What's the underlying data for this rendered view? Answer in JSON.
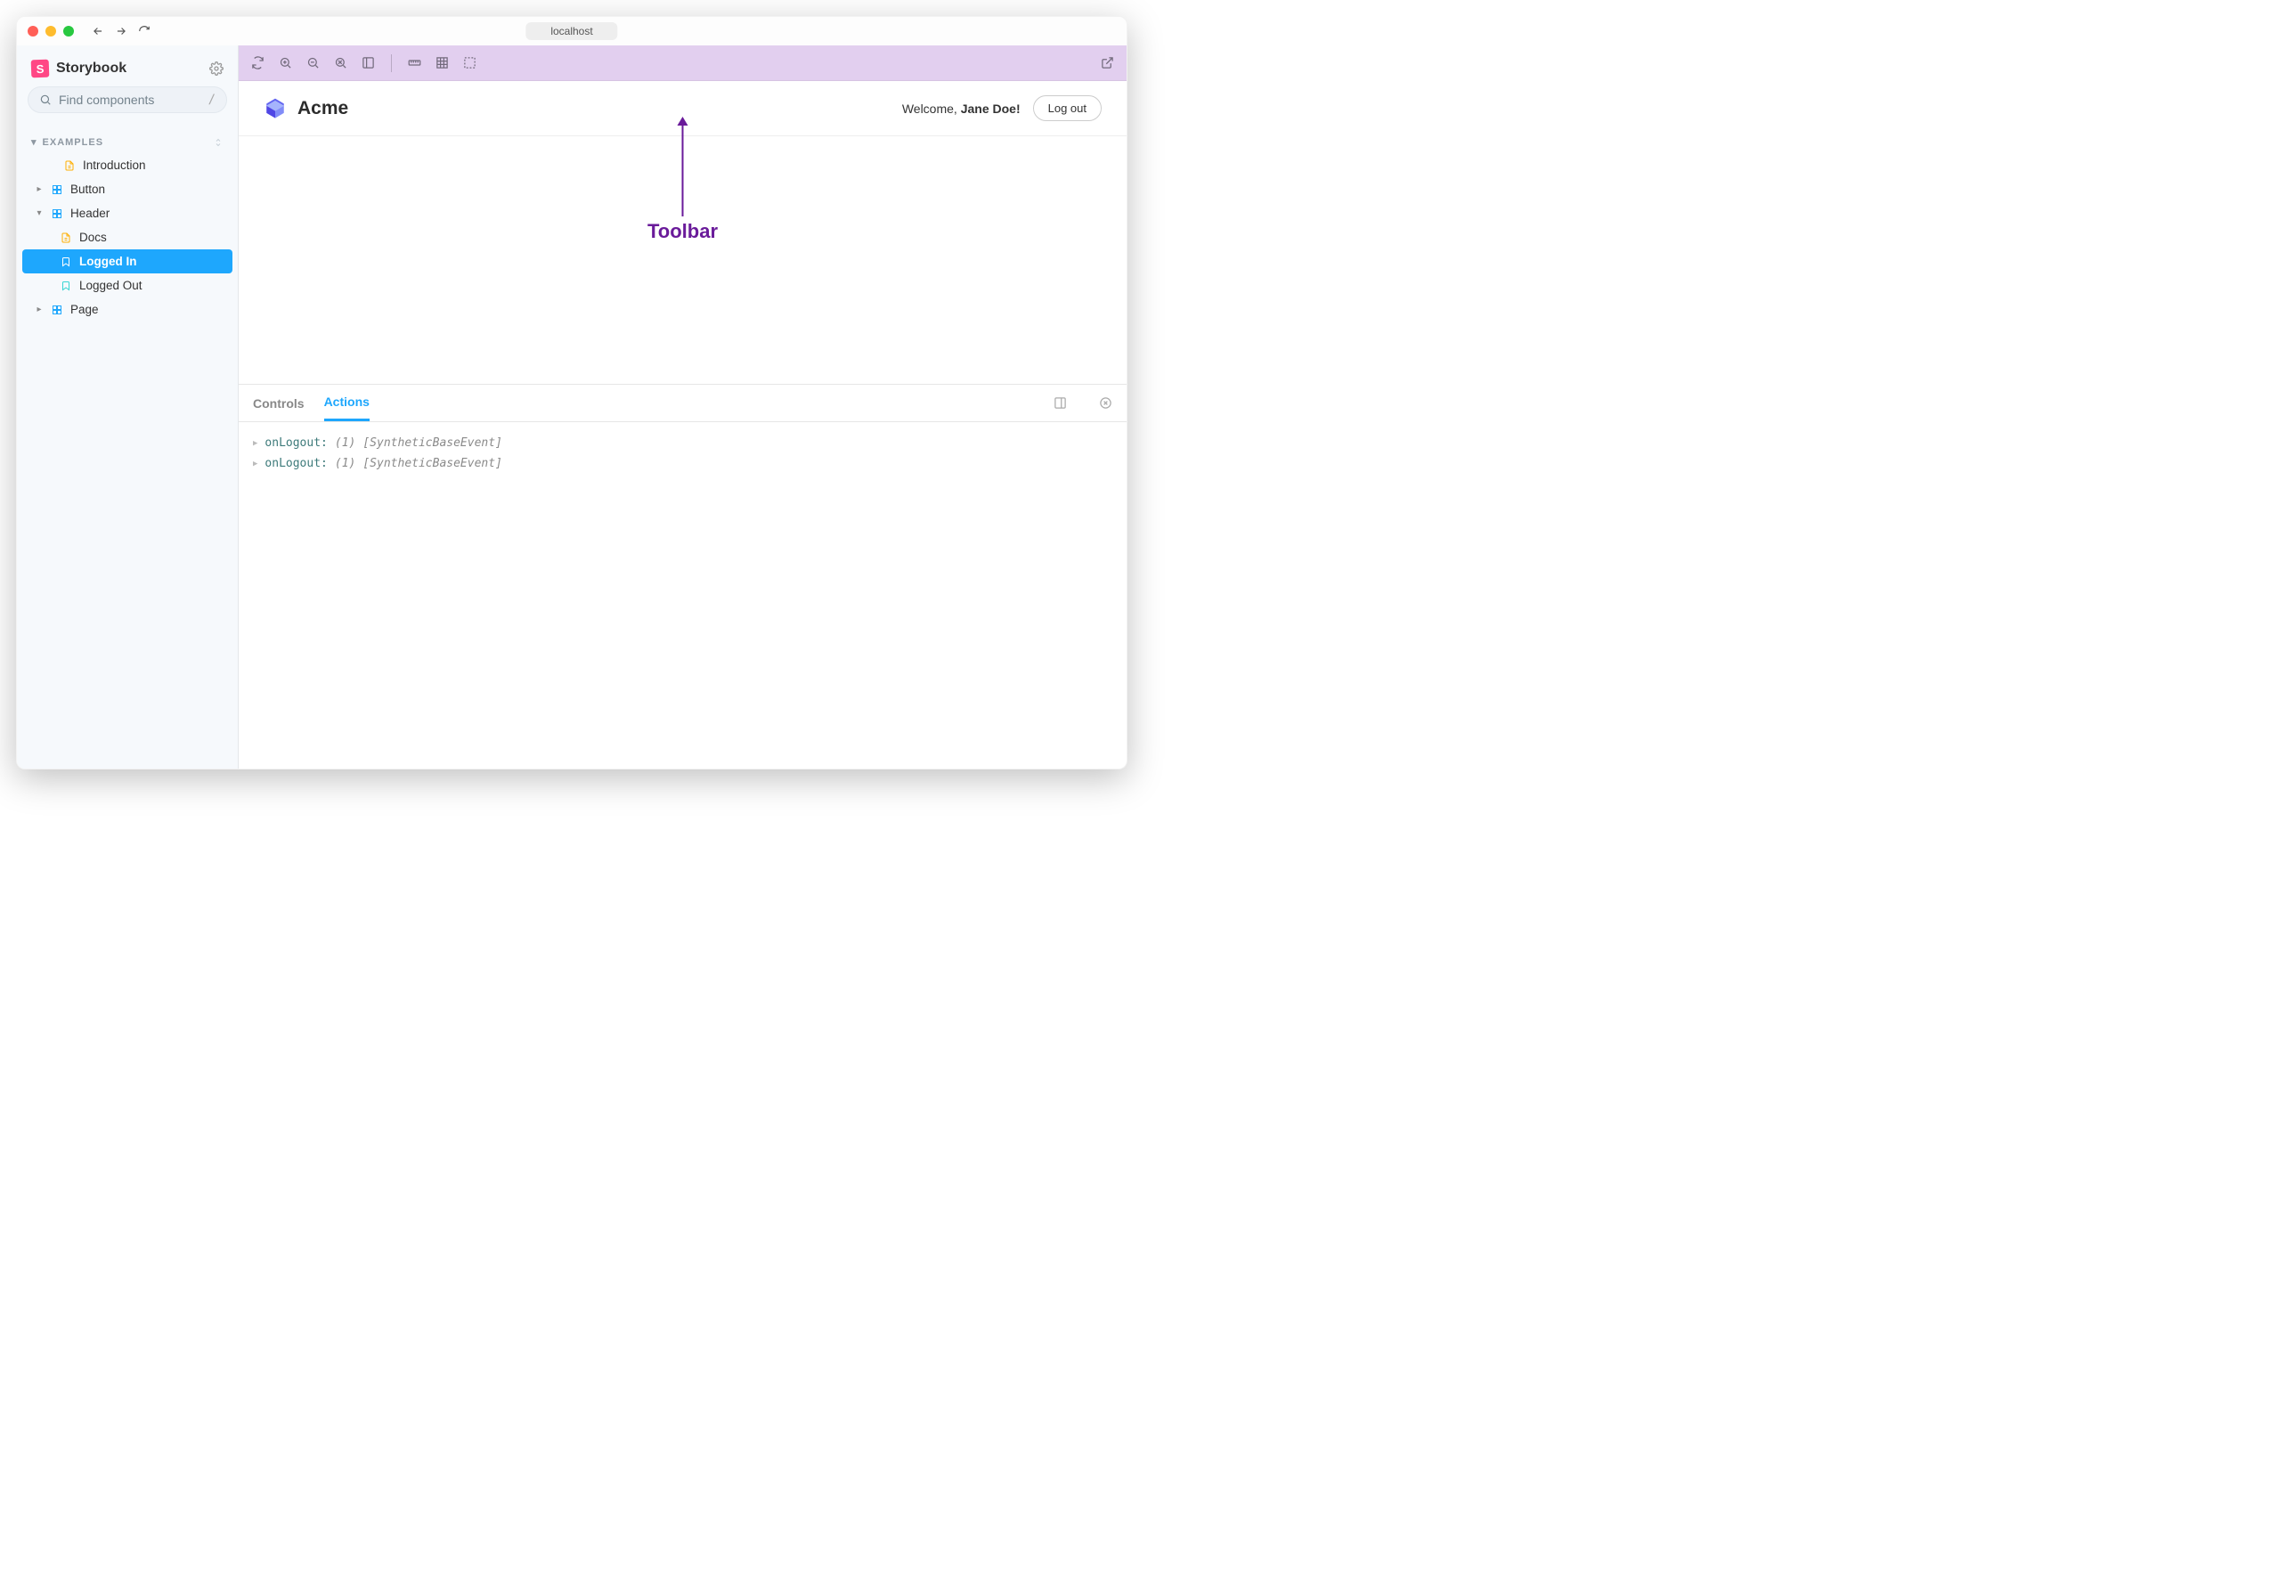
{
  "browser": {
    "url_label": "localhost"
  },
  "app": {
    "name": "Storybook"
  },
  "search": {
    "placeholder": "Find components",
    "shortcut": "/"
  },
  "tree": {
    "heading": "EXAMPLES",
    "items": {
      "intro": "Introduction",
      "button": "Button",
      "header": "Header",
      "docs": "Docs",
      "logged_in": "Logged In",
      "logged_out": "Logged Out",
      "page": "Page"
    }
  },
  "preview": {
    "brand": "Acme",
    "welcome_prefix": "Welcome, ",
    "user_name": "Jane Doe!",
    "logout_label": "Log out"
  },
  "annotation": {
    "label": "Toolbar"
  },
  "addons": {
    "tabs": {
      "controls": "Controls",
      "actions": "Actions"
    },
    "logs": [
      {
        "event": "onLogout:",
        "count": "(1)",
        "type": "[SyntheticBaseEvent]"
      },
      {
        "event": "onLogout:",
        "count": "(1)",
        "type": "[SyntheticBaseEvent]"
      }
    ]
  },
  "colors": {
    "accent": "#1ea7fd",
    "toolbar_bg": "#e2cfef",
    "annotation": "#6a1b9a",
    "doc_icon": "#ffae00",
    "story_icon": "#37d5d3"
  }
}
